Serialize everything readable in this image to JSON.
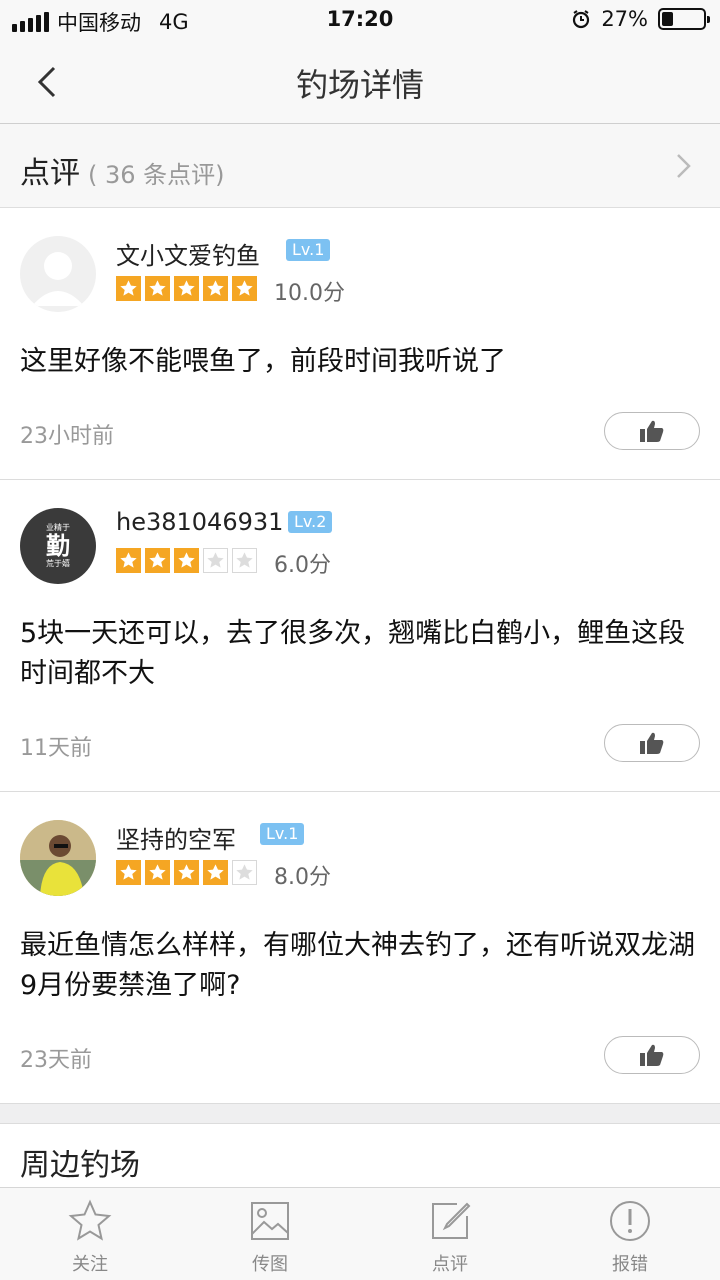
{
  "status_bar": {
    "carrier": "中国移动",
    "network": "4G",
    "time": "17:20",
    "battery": "27%",
    "battery_level": 0.27
  },
  "nav": {
    "title": "钓场详情"
  },
  "reviews_header": {
    "label": "点评",
    "count_text": "( 36 条点评)"
  },
  "reviews": [
    {
      "username": "文小文爱钓鱼",
      "level": "Lv.1",
      "rating": 5,
      "score": "10.0分",
      "content": "这里好像不能喂鱼了，前段时间我听说了",
      "time": "23小时前"
    },
    {
      "username": "he381046931",
      "level": "Lv.2",
      "rating": 3,
      "score": "6.0分",
      "content": "5块一天还可以，去了很多次，翘嘴比白鹤小，鲤鱼这段时间都不大",
      "time": "11天前",
      "avatar_text_top": "业精于",
      "avatar_text_main": "勤",
      "avatar_text_bottom": "荒于嬉"
    },
    {
      "username": "坚持的空军",
      "level": "Lv.1",
      "rating": 4,
      "score": "8.0分",
      "content": "最近鱼情怎么样样，有哪位大神去钓了，还有听说双龙湖9月份要禁渔了啊?",
      "time": "23天前"
    }
  ],
  "nearby": {
    "label": "周边钓场"
  },
  "tabbar": [
    {
      "label": "关注",
      "icon": "star-icon"
    },
    {
      "label": "传图",
      "icon": "image-icon"
    },
    {
      "label": "点评",
      "icon": "edit-icon"
    },
    {
      "label": "报错",
      "icon": "alert-icon"
    }
  ]
}
